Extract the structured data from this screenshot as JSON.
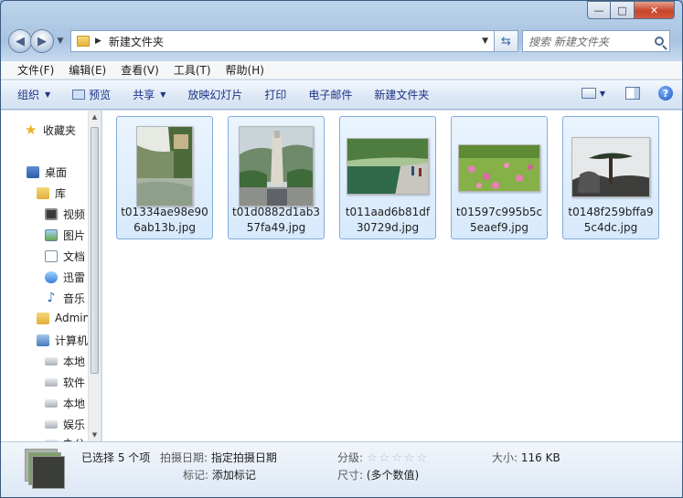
{
  "window": {
    "caption_min": "—",
    "caption_max": "□",
    "caption_close": "✕"
  },
  "address": {
    "path": "新建文件夹",
    "search_placeholder": "搜索 新建文件夹"
  },
  "menubar": [
    "文件(F)",
    "编辑(E)",
    "查看(V)",
    "工具(T)",
    "帮助(H)"
  ],
  "toolbar": {
    "organize": "组织",
    "preview": "预览",
    "share": "共享",
    "slideshow": "放映幻灯片",
    "print": "打印",
    "email": "电子邮件",
    "new_folder": "新建文件夹"
  },
  "nav": {
    "favorites": "收藏夹",
    "desktop": "桌面",
    "library": "库",
    "video": "视频",
    "pictures": "图片",
    "documents": "文档",
    "xunlei": "迅雷",
    "music": "音乐",
    "admin": "Admin",
    "computer": "计算机",
    "local_disk_1": "本地",
    "software": "软件",
    "local_disk_2": "本地",
    "entertainment": "娱乐",
    "partial": "办公"
  },
  "files": [
    {
      "name": "t01334ae98e906ab13b.jpg"
    },
    {
      "name": "t01d0882d1ab357fa49.jpg"
    },
    {
      "name": "t011aad6b81df30729d.jpg"
    },
    {
      "name": "t01597c995b5c5eaef9.jpg"
    },
    {
      "name": "t0148f259bffa95c4dc.jpg"
    }
  ],
  "details": {
    "selected": "已选择 5 个项",
    "date_taken_label": "拍摄日期:",
    "date_taken_value": "指定拍摄日期",
    "tags_label": "标记:",
    "tags_value": "添加标记",
    "rating_label": "分级:",
    "rating_stars": "☆☆☆☆☆",
    "dimensions_label": "尺寸:",
    "dimensions_value": "(多个数值)",
    "size_label": "大小:",
    "size_value": "116 KB"
  }
}
